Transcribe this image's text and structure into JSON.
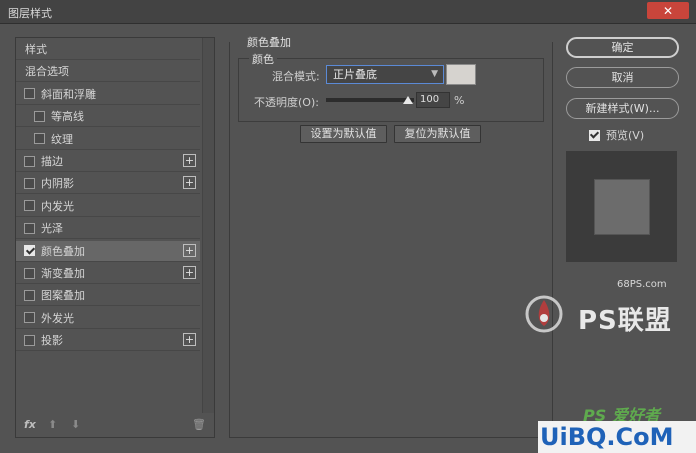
{
  "window": {
    "title": "图层样式",
    "close_glyph": "✕"
  },
  "left_panel": {
    "items": [
      {
        "label": "样式",
        "checkbox": false,
        "checked": false,
        "plus": false,
        "indent": false,
        "active": false
      },
      {
        "label": "混合选项",
        "checkbox": false,
        "checked": false,
        "plus": false,
        "indent": false,
        "active": false
      },
      {
        "label": "斜面和浮雕",
        "checkbox": true,
        "checked": false,
        "plus": false,
        "indent": false,
        "active": false
      },
      {
        "label": "等高线",
        "checkbox": true,
        "checked": false,
        "plus": false,
        "indent": true,
        "active": false
      },
      {
        "label": "纹理",
        "checkbox": true,
        "checked": false,
        "plus": false,
        "indent": true,
        "active": false
      },
      {
        "label": "描边",
        "checkbox": true,
        "checked": false,
        "plus": true,
        "indent": false,
        "active": false
      },
      {
        "label": "内阴影",
        "checkbox": true,
        "checked": false,
        "plus": true,
        "indent": false,
        "active": false
      },
      {
        "label": "内发光",
        "checkbox": true,
        "checked": false,
        "plus": false,
        "indent": false,
        "active": false
      },
      {
        "label": "光泽",
        "checkbox": true,
        "checked": false,
        "plus": false,
        "indent": false,
        "active": false
      },
      {
        "label": "颜色叠加",
        "checkbox": true,
        "checked": true,
        "plus": true,
        "indent": false,
        "active": true
      },
      {
        "label": "渐变叠加",
        "checkbox": true,
        "checked": false,
        "plus": true,
        "indent": false,
        "active": false
      },
      {
        "label": "图案叠加",
        "checkbox": true,
        "checked": false,
        "plus": false,
        "indent": false,
        "active": false
      },
      {
        "label": "外发光",
        "checkbox": true,
        "checked": false,
        "plus": false,
        "indent": false,
        "active": false
      },
      {
        "label": "投影",
        "checkbox": true,
        "checked": false,
        "plus": true,
        "indent": false,
        "active": false
      }
    ],
    "footer": {
      "fx": "fx",
      "up": "⬆",
      "down": "⬇",
      "trash": "🗑"
    }
  },
  "color_overlay": {
    "group_title": "颜色叠加",
    "sub_title": "颜色",
    "blend_label": "混合模式:",
    "blend_value": "正片叠底",
    "swatch_color": "#d6d3cf",
    "opacity_label": "不透明度(O):",
    "opacity_value": "100",
    "opacity_unit": "%",
    "opacity_fraction": 1.0,
    "make_default": "设置为默认值",
    "reset_default": "复位为默认值"
  },
  "right_panel": {
    "ok": "确定",
    "cancel": "取消",
    "new_style": "新建样式(W)...",
    "preview_label": "预览(V)",
    "preview_checked": true
  },
  "watermarks": {
    "site_small": "68PS.com",
    "site_big": "PS联盟",
    "ps_text": "PS 爱好者",
    "uibq": "UiBQ.CoM"
  }
}
